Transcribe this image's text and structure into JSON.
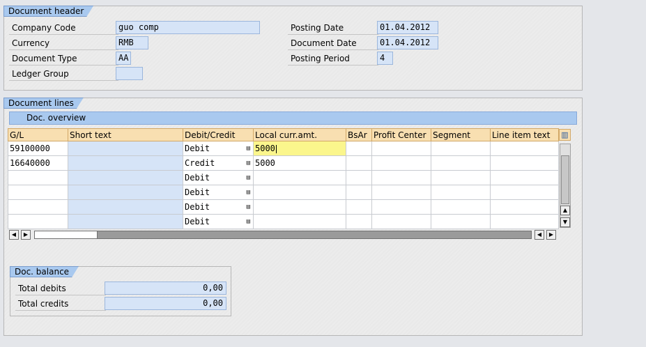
{
  "header": {
    "title": "Document header",
    "company_code_label": "Company Code",
    "company_code_value": "guo comp",
    "currency_label": "Currency",
    "currency_value": "RMB",
    "doc_type_label": "Document Type",
    "doc_type_value": "AA",
    "ledger_group_label": "Ledger Group",
    "ledger_group_value": "",
    "posting_date_label": "Posting Date",
    "posting_date_value": "01.04.2012",
    "document_date_label": "Document Date",
    "document_date_value": "01.04.2012",
    "posting_period_label": "Posting Period",
    "posting_period_value": "4"
  },
  "lines": {
    "title": "Document lines",
    "overview_label": "Doc. overview",
    "columns": [
      "G/L",
      "Short text",
      "Debit/Credit",
      "Local curr.amt.",
      "BsAr",
      "Profit Center",
      "Segment",
      "Line item text"
    ],
    "rows": [
      {
        "gl": "59100000",
        "short": "",
        "dc": "Debit",
        "amt": ""
      },
      {
        "gl": "16640000",
        "short": "",
        "dc": "Credit",
        "amt": "5000"
      },
      {
        "gl": "",
        "short": "",
        "dc": "Debit",
        "amt": ""
      },
      {
        "gl": "",
        "short": "",
        "dc": "Debit",
        "amt": ""
      },
      {
        "gl": "",
        "short": "",
        "dc": "Debit",
        "amt": ""
      },
      {
        "gl": "",
        "short": "",
        "dc": "Debit",
        "amt": ""
      }
    ],
    "editing_amount": "5000"
  },
  "balance": {
    "title": "Doc. balance",
    "total_debits_label": "Total debits",
    "total_debits_value": "0,00",
    "total_credits_label": "Total credits",
    "total_credits_value": "0,00"
  },
  "icons": {
    "table_config": "table-settings-icon",
    "value_help": "value-help-icon"
  }
}
